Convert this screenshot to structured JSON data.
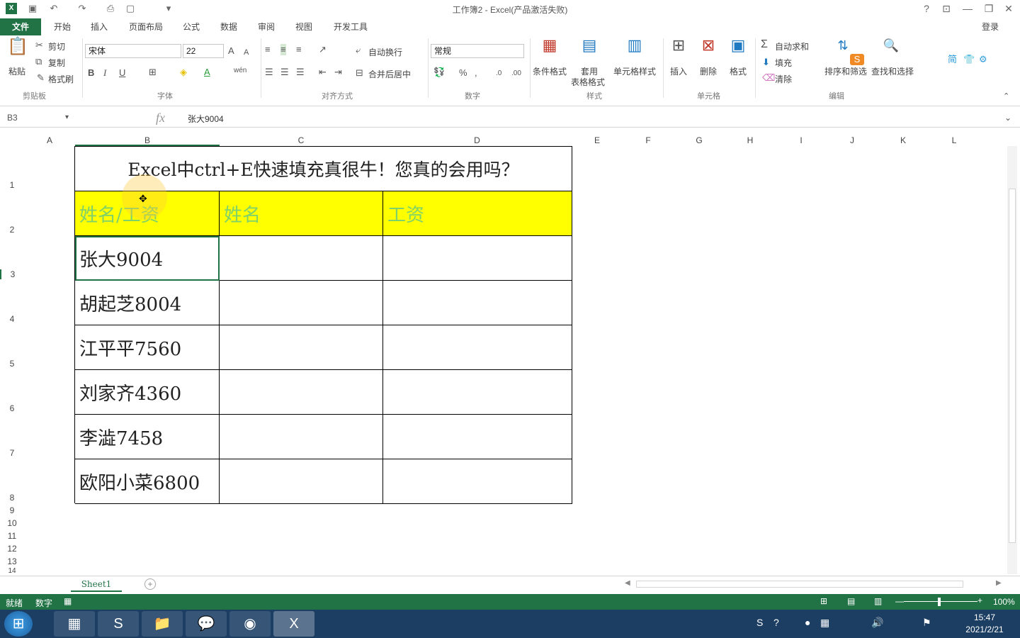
{
  "window": {
    "title": "工作簿2 - Excel(产品激活失败)",
    "login": "登录"
  },
  "tabs": [
    "文件",
    "开始",
    "插入",
    "页面布局",
    "公式",
    "数据",
    "审阅",
    "视图",
    "开发工具"
  ],
  "ribbon": {
    "clipboard": {
      "paste": "粘贴",
      "cut": "剪切",
      "copy": "复制",
      "format_painter": "格式刷",
      "label": "剪贴板"
    },
    "font": {
      "name": "宋体",
      "size": "22",
      "bold": "B",
      "italic": "I",
      "underline": "U",
      "label": "字体"
    },
    "alignment": {
      "wrap": "自动换行",
      "merge": "合并后居中",
      "label": "对齐方式"
    },
    "number": {
      "format": "常规",
      "percent": "%",
      "label": "数字"
    },
    "styles": {
      "conditional": "条件格式",
      "table_format_1": "套用",
      "table_format_2": "表格格式",
      "cell_styles": "单元格样式",
      "label": "样式"
    },
    "cells": {
      "insert": "插入",
      "delete": "删除",
      "format": "格式",
      "label": "单元格"
    },
    "editing": {
      "autosum": "自动求和",
      "fill": "填充",
      "clear": "清除",
      "sort": "排序和筛选",
      "find": "查找和选择",
      "label": "编辑"
    }
  },
  "formula_bar": {
    "name_box": "B3",
    "fx": "fx",
    "value": "张大9004"
  },
  "columns": [
    "A",
    "B",
    "C",
    "D",
    "E",
    "F",
    "G",
    "H",
    "I",
    "J",
    "K",
    "L"
  ],
  "rows": [
    "1",
    "2",
    "3",
    "4",
    "5",
    "6",
    "7",
    "8",
    "9",
    "10",
    "11",
    "12",
    "13",
    "14"
  ],
  "sheet": {
    "title": "Excel中ctrl+E快速填充真很牛！您真的会用吗？",
    "headers": [
      "姓名/工资",
      "姓名",
      "工资"
    ],
    "data": [
      "张大9004",
      "胡起芝8004",
      "江平平7560",
      "刘家齐4360",
      "李澁7458",
      "欧阳小菜6800"
    ]
  },
  "sheet_tab": "Sheet1",
  "status": {
    "ready": "就绪",
    "mode": "数字",
    "zoom": "100%"
  },
  "taskbar": {
    "time": "15:47",
    "date": "2021/2/21"
  },
  "colors": {
    "accent": "#217346",
    "header_fill": "#ffff00",
    "header_text": "#7fd16a"
  }
}
